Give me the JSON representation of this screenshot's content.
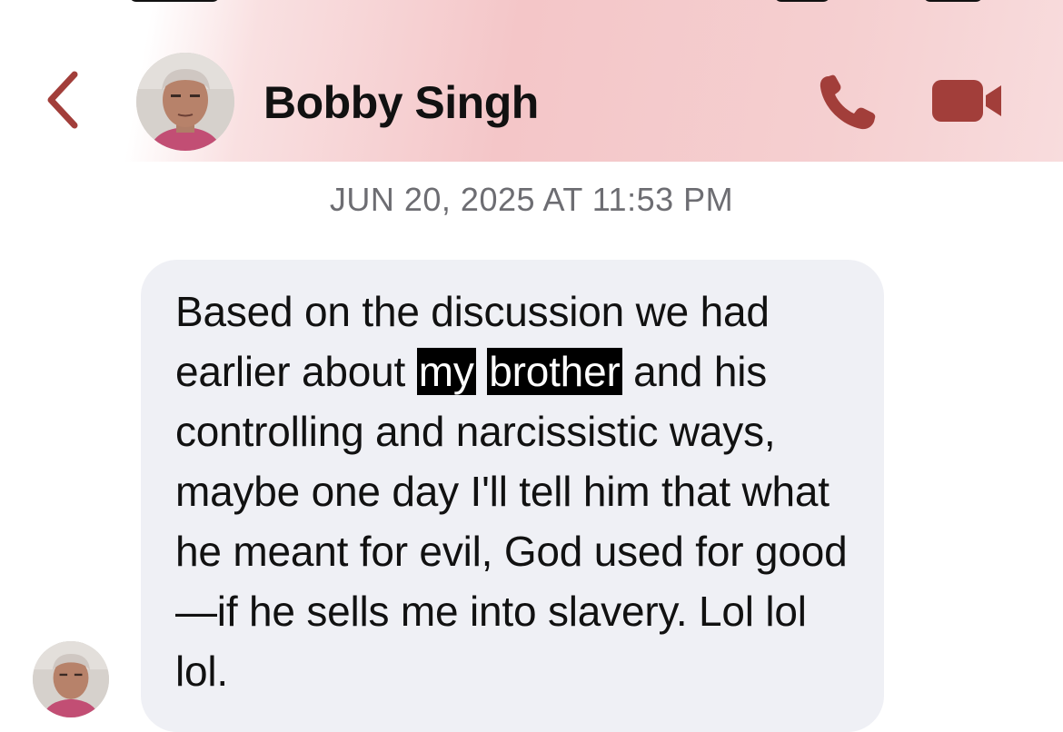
{
  "header": {
    "contact_name": "Bobby Singh",
    "back_icon": "chevron-left-icon",
    "phone_icon": "phone-icon",
    "video_icon": "video-camera-icon",
    "accent_color": "#a23e3a"
  },
  "conversation": {
    "timestamp": "JUN 20, 2025 AT 11:53 PM",
    "message": {
      "segments": [
        {
          "text": "Based on the discussion we had earlier about ",
          "highlight": false
        },
        {
          "text": "my",
          "highlight": true
        },
        {
          "text": " ",
          "highlight": false
        },
        {
          "text": "brother",
          "highlight": true
        },
        {
          "text": " and his controlling and narcissistic ways, maybe one day I'll tell him that what he meant for evil, God used for good—if he sells me into slavery. Lol lol lol.",
          "highlight": false
        }
      ]
    }
  }
}
